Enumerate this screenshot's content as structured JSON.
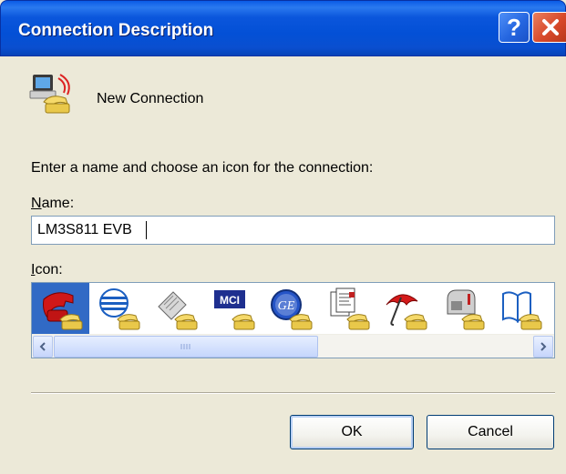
{
  "window": {
    "title": "Connection Description",
    "help_label": "?",
    "close_icon": "close-icon"
  },
  "connection": {
    "display_name": "New Connection",
    "icon": "phone-computer-icon"
  },
  "prompt": "Enter a name and choose an icon for the connection:",
  "name_field": {
    "label_accel": "N",
    "label_rest": "ame:",
    "value": "LM3S811 EVB"
  },
  "icon_field": {
    "label_accel": "I",
    "label_rest": "con:",
    "icons": [
      {
        "name": "red-phone-icon",
        "selected": true
      },
      {
        "name": "globe-phone-icon",
        "selected": false
      },
      {
        "name": "fax-phone-icon",
        "selected": false
      },
      {
        "name": "mci-phone-icon",
        "selected": false
      },
      {
        "name": "ge-phone-icon",
        "selected": false
      },
      {
        "name": "documents-phone-icon",
        "selected": false
      },
      {
        "name": "umbrella-phone-icon",
        "selected": false
      },
      {
        "name": "mailbox-phone-icon",
        "selected": false
      },
      {
        "name": "book-phone-icon",
        "selected": false
      }
    ],
    "mci_text": "MCI",
    "ge_text": "GE"
  },
  "buttons": {
    "ok_label": "OK",
    "cancel_label": "Cancel"
  },
  "colors": {
    "titlebar": "#0350d6",
    "selection": "#316ac5",
    "dialog_bg": "#ece9d8"
  }
}
